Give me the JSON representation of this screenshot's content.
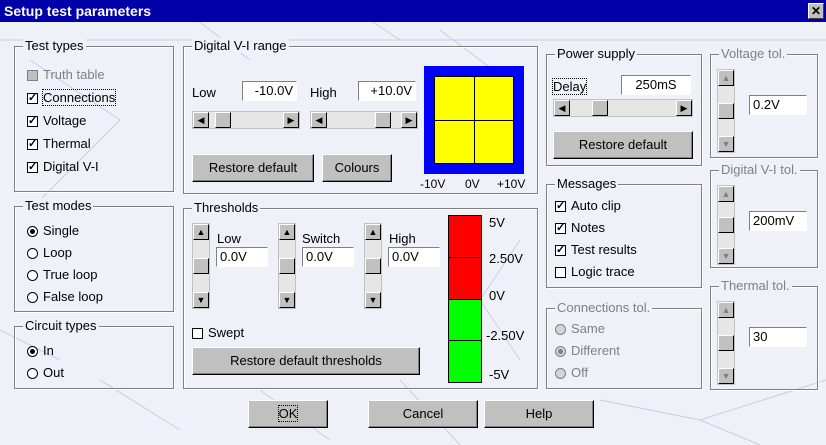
{
  "title": "Setup test parameters",
  "test_types": {
    "legend": "Test types",
    "items": [
      {
        "label": "Truth table",
        "checked": false,
        "enabled": false
      },
      {
        "label": "Connections",
        "checked": true,
        "enabled": true
      },
      {
        "label": "Voltage",
        "checked": true,
        "enabled": true
      },
      {
        "label": "Thermal",
        "checked": true,
        "enabled": true
      },
      {
        "label": "Digital V-I",
        "checked": true,
        "enabled": true
      }
    ]
  },
  "test_modes": {
    "legend": "Test modes",
    "items": [
      {
        "label": "Single",
        "selected": true
      },
      {
        "label": "Loop",
        "selected": false
      },
      {
        "label": "True loop",
        "selected": false
      },
      {
        "label": "False loop",
        "selected": false
      }
    ]
  },
  "circuit_types": {
    "legend": "Circuit types",
    "items": [
      {
        "label": "In",
        "selected": true
      },
      {
        "label": "Out",
        "selected": false
      }
    ]
  },
  "digital_vi_range": {
    "legend": "Digital V-I range",
    "low_label": "Low",
    "low_value": "-10.0V",
    "high_label": "High",
    "high_value": "+10.0V",
    "restore_label": "Restore default",
    "colours_label": "Colours",
    "axis": [
      "-10V",
      "0V",
      "+10V"
    ],
    "preview_colors": {
      "frame": "#0000ff",
      "fill": "#ffff00"
    }
  },
  "thresholds": {
    "legend": "Thresholds",
    "low_label": "Low",
    "low_value": "0.0V",
    "switch_label": "Switch",
    "switch_value": "0.0V",
    "high_label": "High",
    "high_value": "0.0V",
    "swept_label": "Swept",
    "swept_checked": false,
    "restore_label": "Restore default thresholds",
    "scale": [
      "5V",
      "2.50V",
      "0V",
      "-2.50V",
      "-5V"
    ],
    "colors": {
      "upper": "#ff0000",
      "lower": "#00ff00"
    }
  },
  "power_supply": {
    "legend": "Power supply",
    "delay_label": "Delay",
    "delay_value": "250mS",
    "restore_label": "Restore default"
  },
  "messages": {
    "legend": "Messages",
    "items": [
      {
        "label": "Auto clip",
        "checked": true
      },
      {
        "label": "Notes",
        "checked": true
      },
      {
        "label": "Test results",
        "checked": true
      },
      {
        "label": "Logic trace",
        "checked": false
      }
    ]
  },
  "connections_tol": {
    "legend": "Connections tol.",
    "items": [
      {
        "label": "Same",
        "selected": false
      },
      {
        "label": "Different",
        "selected": true
      },
      {
        "label": "Off",
        "selected": false
      }
    ]
  },
  "voltage_tol": {
    "legend": "Voltage tol.",
    "value": "0.2V"
  },
  "digital_vi_tol": {
    "legend": "Digital V-I tol.",
    "value": "200mV"
  },
  "thermal_tol": {
    "legend": "Thermal tol.",
    "value": "30"
  },
  "buttons": {
    "ok": "OK",
    "cancel": "Cancel",
    "help": "Help"
  }
}
